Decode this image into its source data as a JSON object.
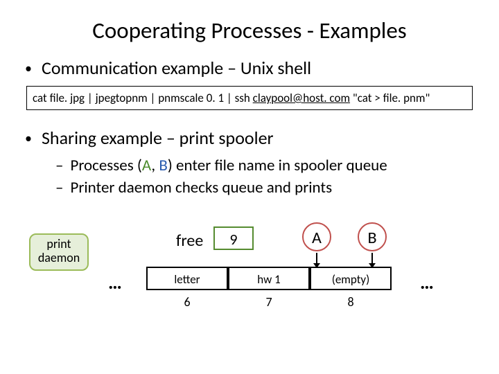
{
  "title": "Cooperating Processes - Examples",
  "bullet1": "Communication example – Unix shell",
  "code": {
    "prefix": "cat file. jpg | jpegtopnm | pnmscale 0. 1 | ssh ",
    "underlined": "claypool@host. com",
    "suffix": " \"cat > file. pnm\""
  },
  "bullet2": "Sharing example – print spooler",
  "sub1": {
    "pre": "Processes (",
    "a": "A",
    "mid": ", ",
    "b": "B",
    "post": ") enter file name in spooler queue"
  },
  "sub2": "Printer daemon checks queue and prints",
  "diagram": {
    "pd_line1": "print",
    "pd_line2": "daemon",
    "free_label": "free",
    "free_value": "9",
    "procA": "A",
    "procB": "B",
    "ellipsis": "…",
    "cells": [
      "letter",
      "hw 1",
      "(empty)"
    ],
    "indices": [
      "6",
      "7",
      "8"
    ]
  }
}
